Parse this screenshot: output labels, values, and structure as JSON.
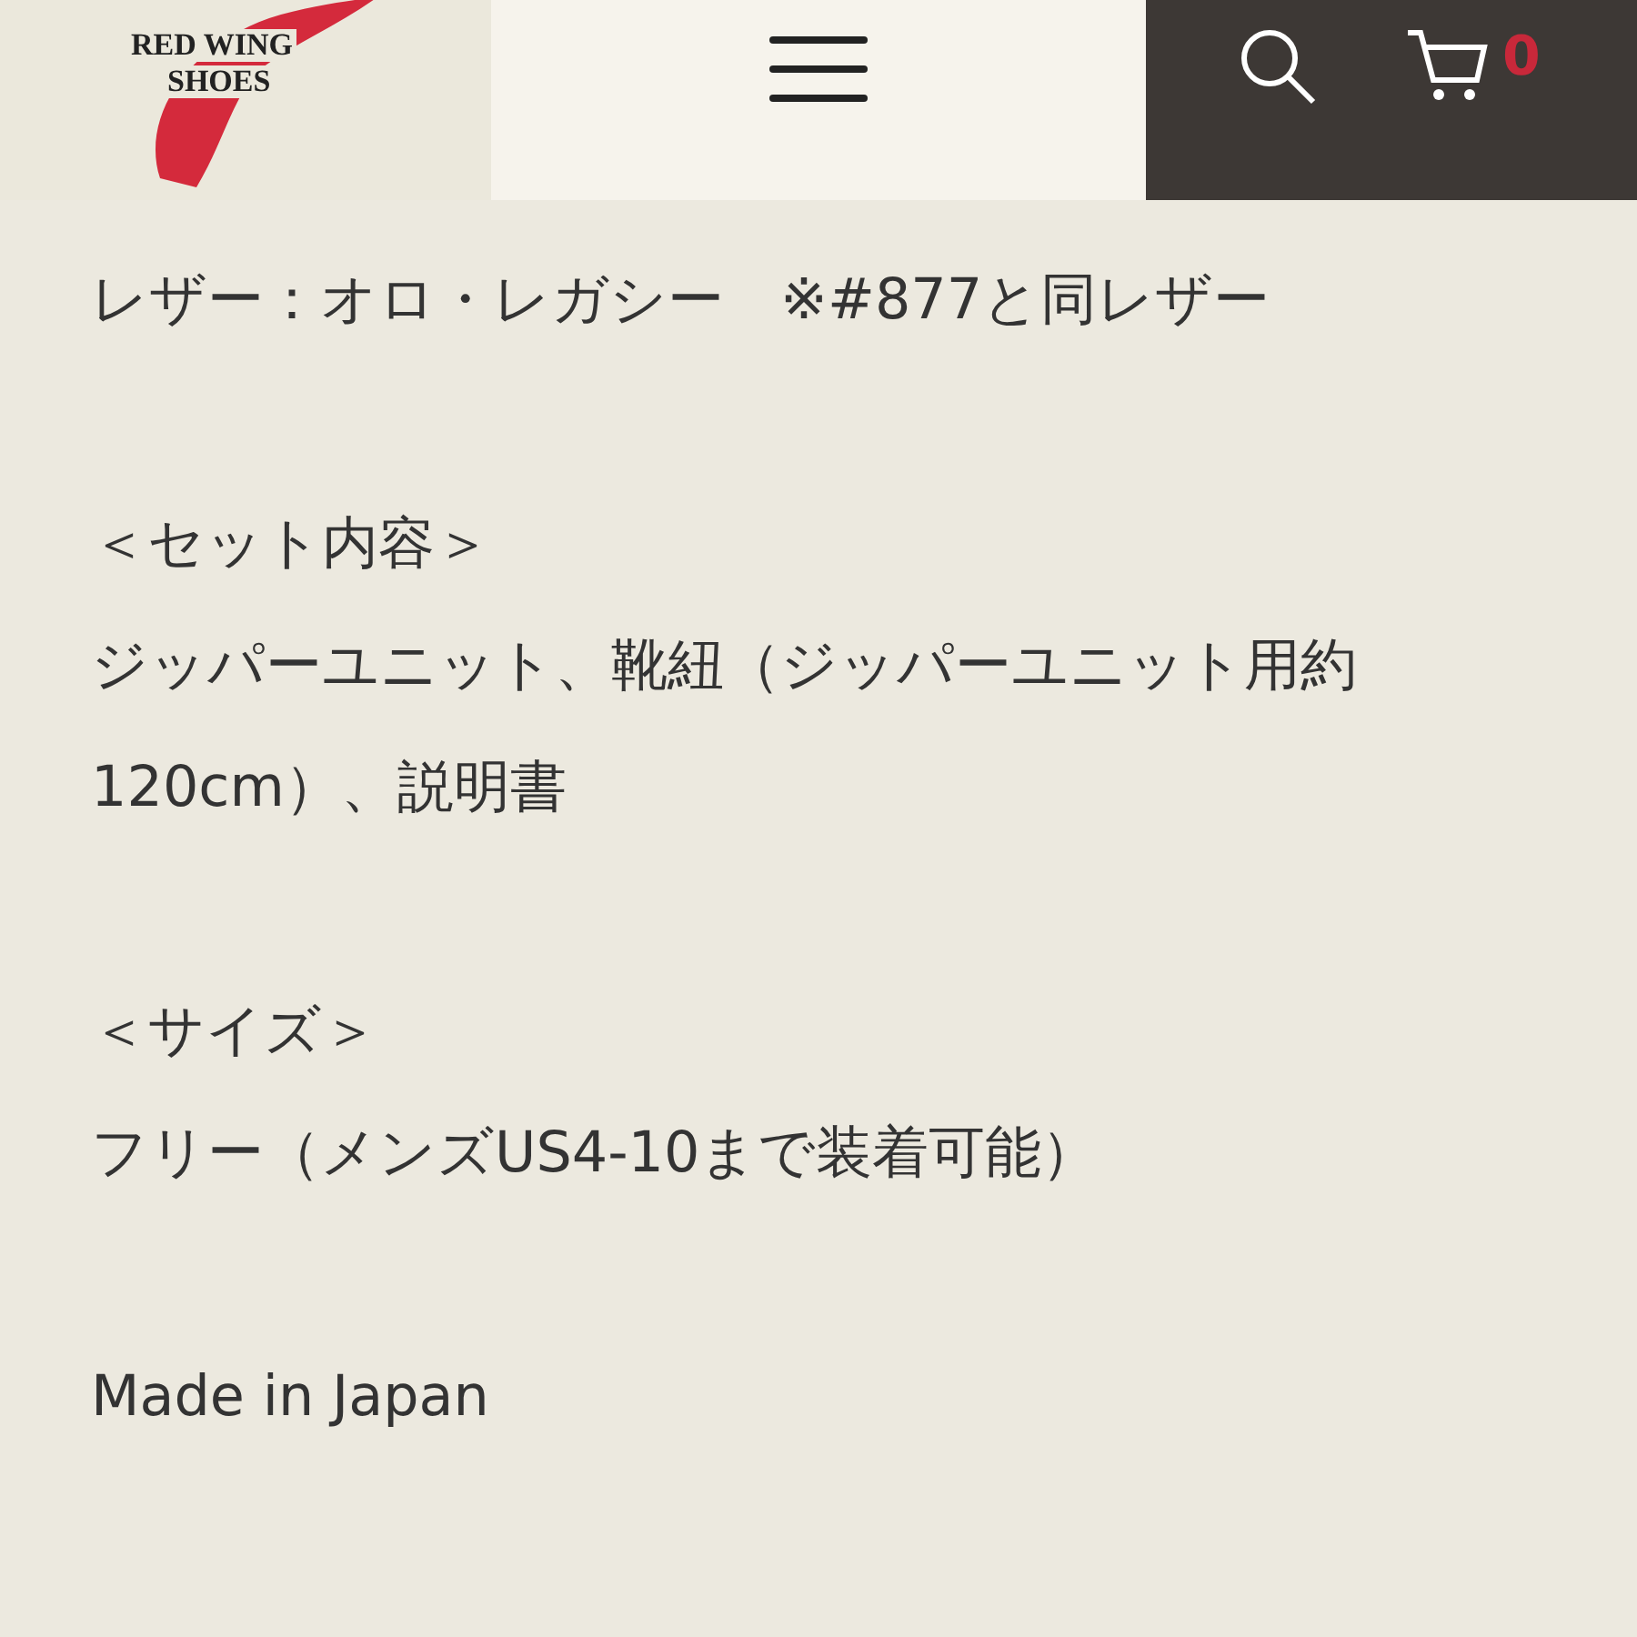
{
  "header": {
    "logo": {
      "line_1": "RED WING",
      "line_2": "SHOES"
    },
    "cart_count": "0"
  },
  "blocks": [
    {
      "lines": [
        "レザー：オロ・レガシー　※#877と同レザー"
      ]
    },
    {
      "lines": [
        "＜セット内容＞",
        "ジッパーユニット、靴紐（ジッパーユニット用約120cm）、説明書"
      ]
    },
    {
      "lines": [
        "＜サイズ＞",
        "フリー（メンズUS4-10まで装着可能）"
      ]
    },
    {
      "lines": [
        "Made in Japan"
      ]
    }
  ]
}
